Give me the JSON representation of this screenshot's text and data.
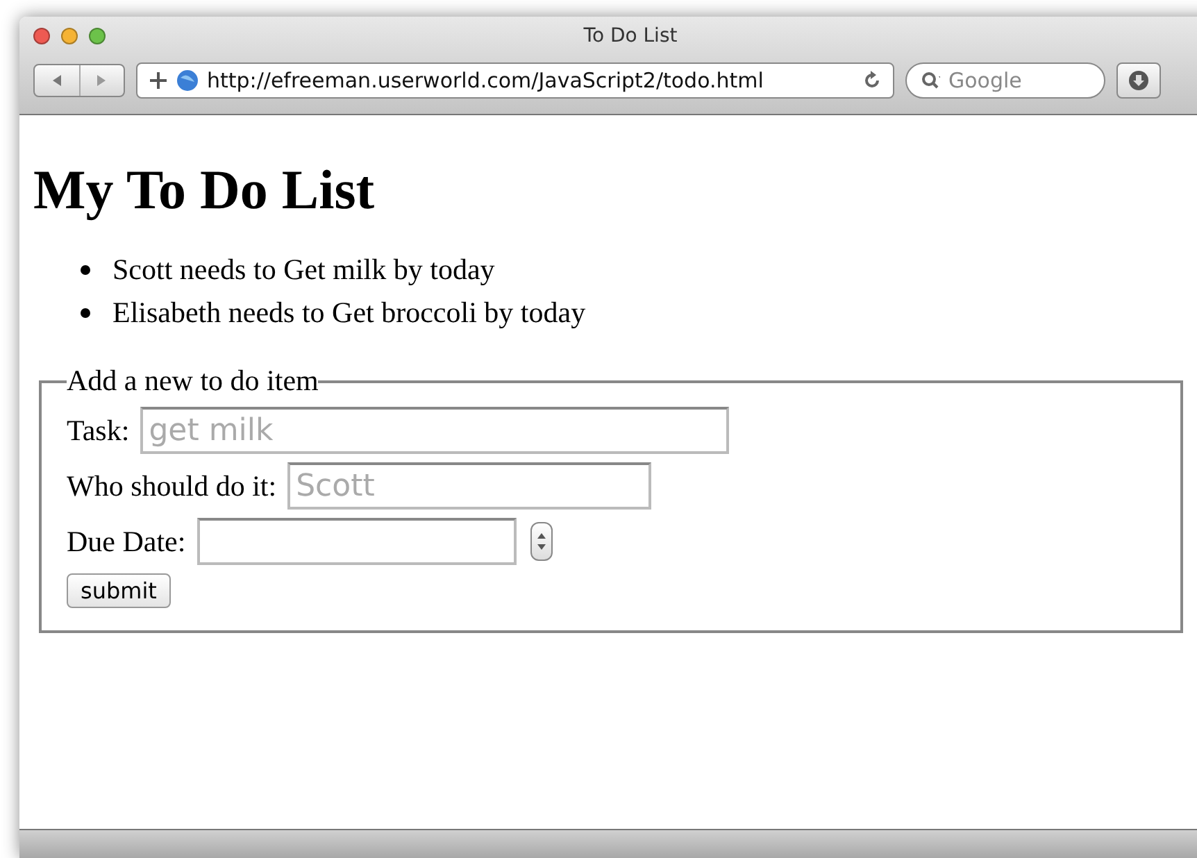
{
  "window": {
    "title": "To Do List"
  },
  "toolbar": {
    "url": "http://efreeman.userworld.com/JavaScript2/todo.html",
    "search": {
      "placeholder": "Google"
    }
  },
  "page": {
    "heading": "My To Do List",
    "items": [
      "Scott needs to Get milk by today",
      "Elisabeth needs to Get broccoli by today"
    ],
    "form": {
      "legend": "Add a new to do item",
      "fields": [
        {
          "kind": "text",
          "label": "Task:",
          "placeholder": "get milk"
        },
        {
          "kind": "text",
          "label": "Who should do it:",
          "placeholder": "Scott"
        },
        {
          "kind": "date",
          "label": "Due Date:"
        }
      ],
      "submit": "submit"
    }
  }
}
